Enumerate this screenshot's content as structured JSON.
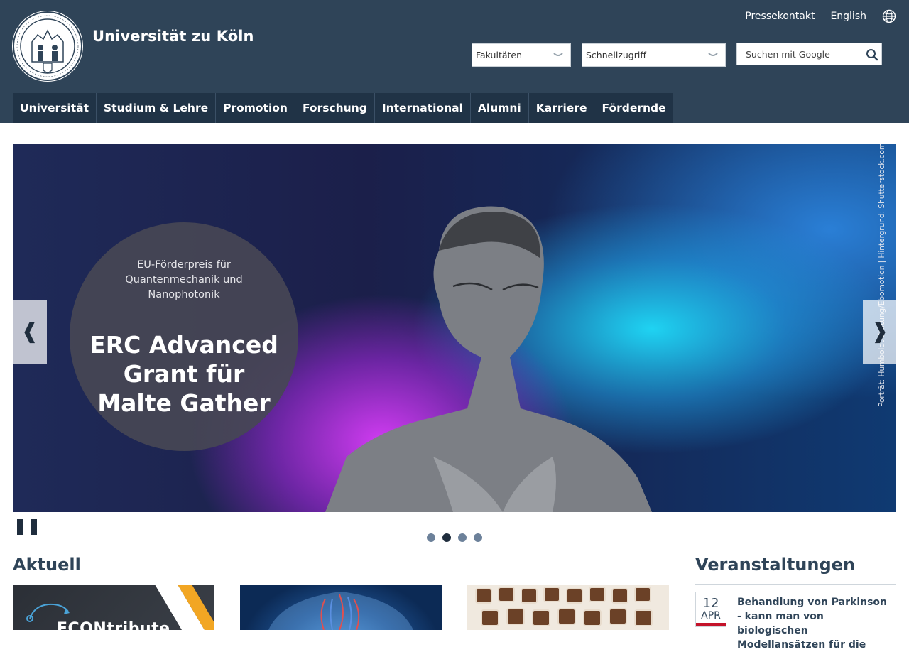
{
  "header": {
    "brand": "Universität zu Köln",
    "top_links": [
      "Pressekontakt",
      "English"
    ],
    "globe_icon": "globe-icon",
    "seal_icon": "university-seal-icon",
    "faculties_select": "Fakultäten",
    "quick_select": "Schnellzugriff",
    "search_placeholder": "Suchen mit Google"
  },
  "nav": {
    "items": [
      "Universität",
      "Studium & Lehre",
      "Promotion",
      "Forschung",
      "International",
      "Alumni",
      "Karriere",
      "Fördernde"
    ]
  },
  "slider": {
    "kicker": "EU-Förderpreis für Quantenmechanik und Nanophotonik",
    "headline": "ERC Advanced Grant für Malte Gather",
    "credit": "Porträt: Humboldt-Stiftung/Ebomotion | Hintergrund: Shutterstock.com",
    "prev": "❰",
    "next": "❱",
    "active_slide": 2,
    "slide_count": 4
  },
  "aktuell": {
    "heading": "Aktuell",
    "tile1_text": "ECONtribute"
  },
  "events": {
    "heading": "Veranstaltungen",
    "items": [
      {
        "day": "12",
        "month": "APR",
        "title": "Behandlung von Parkinson - kann man von biologischen Modellansätzen für die"
      }
    ]
  },
  "colors": {
    "header_bg": "#2f4458",
    "nav_bg": "#203346",
    "accent_red": "#c4132a"
  }
}
